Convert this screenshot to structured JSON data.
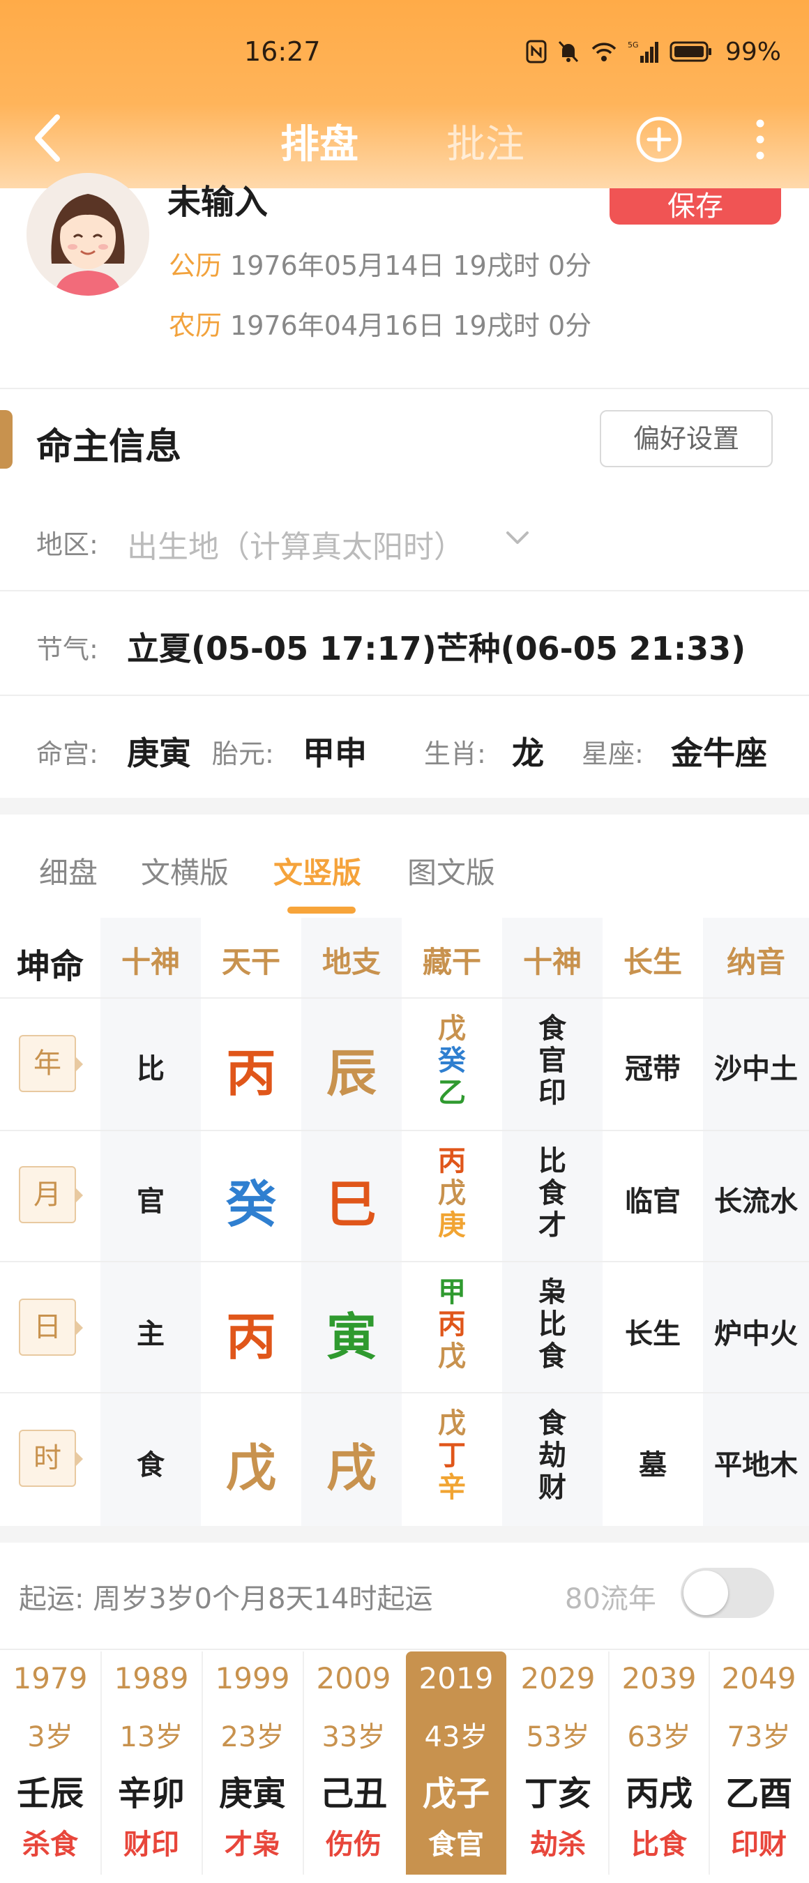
{
  "status": {
    "time": "16:27",
    "battery": "99%"
  },
  "nav": {
    "tab_plate": "排盘",
    "tab_annotation": "批注"
  },
  "profile": {
    "name": "未输入",
    "save_label": "保存",
    "solar_label": "公历",
    "solar_value": "1976年05月14日 19戌时 0分",
    "lunar_label": "农历",
    "lunar_value": "1976年04月16日 19戌时 0分"
  },
  "info": {
    "title": "命主信息",
    "pref_button": "偏好设置",
    "region_label": "地区:",
    "region_placeholder": "出生地（计算真太阳时）",
    "solar_term_label": "节气:",
    "solar_term_value": "立夏(05-05 17:17)芒种(06-05 21:33)",
    "palace_label": "命宫:",
    "palace_value": "庚寅",
    "taiyuan_label": "胎元:",
    "taiyuan_value": "甲申",
    "zodiac_label": "生肖:",
    "zodiac_value": "龙",
    "constellation_label": "星座:",
    "constellation_value": "金牛座"
  },
  "view_tabs": [
    "细盘",
    "文横版",
    "文竖版",
    "图文版"
  ],
  "active_view_tab": "文竖版",
  "grid": {
    "corner": "坤命",
    "headers": [
      "十神",
      "天干",
      "地支",
      "藏干",
      "十神",
      "长生",
      "纳音"
    ],
    "rows": [
      {
        "pillar": "年",
        "shishen": "比",
        "gan": "丙",
        "zhi": "辰",
        "canggan": [
          "戊",
          "癸",
          "乙"
        ],
        "canggan_shishen": [
          "食",
          "官",
          "印"
        ],
        "changsheng": "冠带",
        "nayin": "沙中土"
      },
      {
        "pillar": "月",
        "shishen": "官",
        "gan": "癸",
        "zhi": "巳",
        "canggan": [
          "丙",
          "戊",
          "庚"
        ],
        "canggan_shishen": [
          "比",
          "食",
          "才"
        ],
        "changsheng": "临官",
        "nayin": "长流水"
      },
      {
        "pillar": "日",
        "shishen": "主",
        "gan": "丙",
        "zhi": "寅",
        "canggan": [
          "甲",
          "丙",
          "戊"
        ],
        "canggan_shishen": [
          "枭",
          "比",
          "食"
        ],
        "changsheng": "长生",
        "nayin": "炉中火"
      },
      {
        "pillar": "时",
        "shishen": "食",
        "gan": "戊",
        "zhi": "戌",
        "canggan": [
          "戊",
          "丁",
          "辛"
        ],
        "canggan_shishen": [
          "食",
          "劫",
          "财"
        ],
        "changsheng": "墓",
        "nayin": "平地木"
      }
    ]
  },
  "element_colors": {
    "fire": "#e0561a",
    "earth": "#c8924e",
    "water": "#2f7fd0",
    "wood": "#2f9a2f",
    "metal": "#f1a432"
  },
  "luck": {
    "start_label": "起运:",
    "start_text": "周岁3岁0个月8天14时起运",
    "flow_label": "80流年",
    "flow_toggle_on": false,
    "columns": [
      {
        "year": "1979",
        "age": "3岁",
        "ganzhi": "壬辰",
        "shishen": "杀食"
      },
      {
        "year": "1989",
        "age": "13岁",
        "ganzhi": "辛卯",
        "shishen": "财印"
      },
      {
        "year": "1999",
        "age": "23岁",
        "ganzhi": "庚寅",
        "shishen": "才枭"
      },
      {
        "year": "2009",
        "age": "33岁",
        "ganzhi": "己丑",
        "shishen": "伤伤"
      },
      {
        "year": "2019",
        "age": "43岁",
        "ganzhi": "戊子",
        "shishen": "食官"
      },
      {
        "year": "2029",
        "age": "53岁",
        "ganzhi": "丁亥",
        "shishen": "劫杀"
      },
      {
        "year": "2039",
        "age": "63岁",
        "ganzhi": "丙戌",
        "shishen": "比食"
      },
      {
        "year": "2049",
        "age": "73岁",
        "ganzhi": "乙酉",
        "shishen": "印财"
      }
    ],
    "active_index": 4
  },
  "icons": {
    "back": "back-arrow-icon",
    "add": "add-circle-icon",
    "more": "more-vertical-icon",
    "region_dropdown": "chevron-down-icon"
  }
}
